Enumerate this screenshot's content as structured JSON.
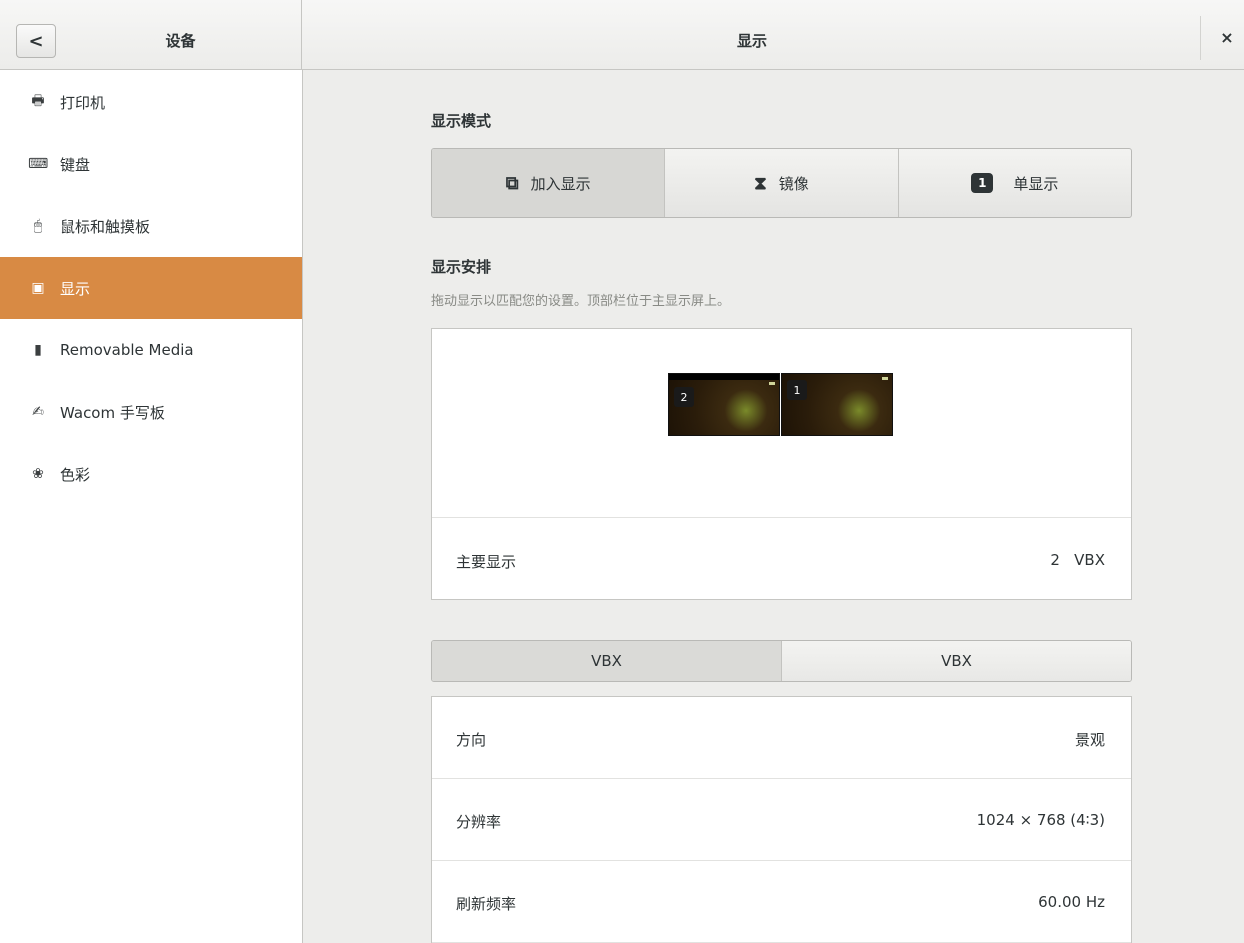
{
  "header": {
    "back_label": "<",
    "left_title": "设备",
    "title": "显示",
    "close_label": "×"
  },
  "sidebar": {
    "items": [
      {
        "label": "打印机",
        "icon": "printer-icon",
        "glyph": "🖶"
      },
      {
        "label": "键盘",
        "icon": "keyboard-icon",
        "glyph": "⌨"
      },
      {
        "label": "鼠标和触摸板",
        "icon": "mouse-icon",
        "glyph": "🖱"
      },
      {
        "label": "显示",
        "icon": "display-icon",
        "glyph": "▣",
        "active": true
      },
      {
        "label": "Removable Media",
        "icon": "usb-icon",
        "glyph": "▮"
      },
      {
        "label": "Wacom 手写板",
        "icon": "tablet-icon",
        "glyph": "✍"
      },
      {
        "label": "色彩",
        "icon": "color-icon",
        "glyph": "❀"
      }
    ]
  },
  "display_mode": {
    "title": "显示模式",
    "options": [
      {
        "label": "加入显示",
        "icon": "join-display-icon",
        "active": true
      },
      {
        "label": "镜像",
        "icon": "mirror-icon",
        "active": false
      },
      {
        "label": "单显示",
        "icon": "single-display-icon",
        "badge": "1",
        "active": false
      }
    ]
  },
  "arrangement": {
    "title": "显示安排",
    "subtitle": "拖动显示以匹配您的设置。顶部栏位于主显示屏上。",
    "monitors": [
      {
        "number": "2",
        "has_top_bar": true
      },
      {
        "number": "1",
        "has_top_bar": false
      }
    ],
    "primary_label": "主要显示",
    "primary_value": "2   VBX"
  },
  "monitor_tabs": [
    {
      "label": "VBX",
      "active": true
    },
    {
      "label": "VBX",
      "active": false
    }
  ],
  "settings": [
    {
      "label": "方向",
      "value": "景观"
    },
    {
      "label": "分辨率",
      "value": "1024 × 768 (4∶3)"
    },
    {
      "label": "刷新频率",
      "value": "60.00 Hz"
    }
  ],
  "colors": {
    "accent": "#d88a44",
    "background": "#ededeb"
  }
}
